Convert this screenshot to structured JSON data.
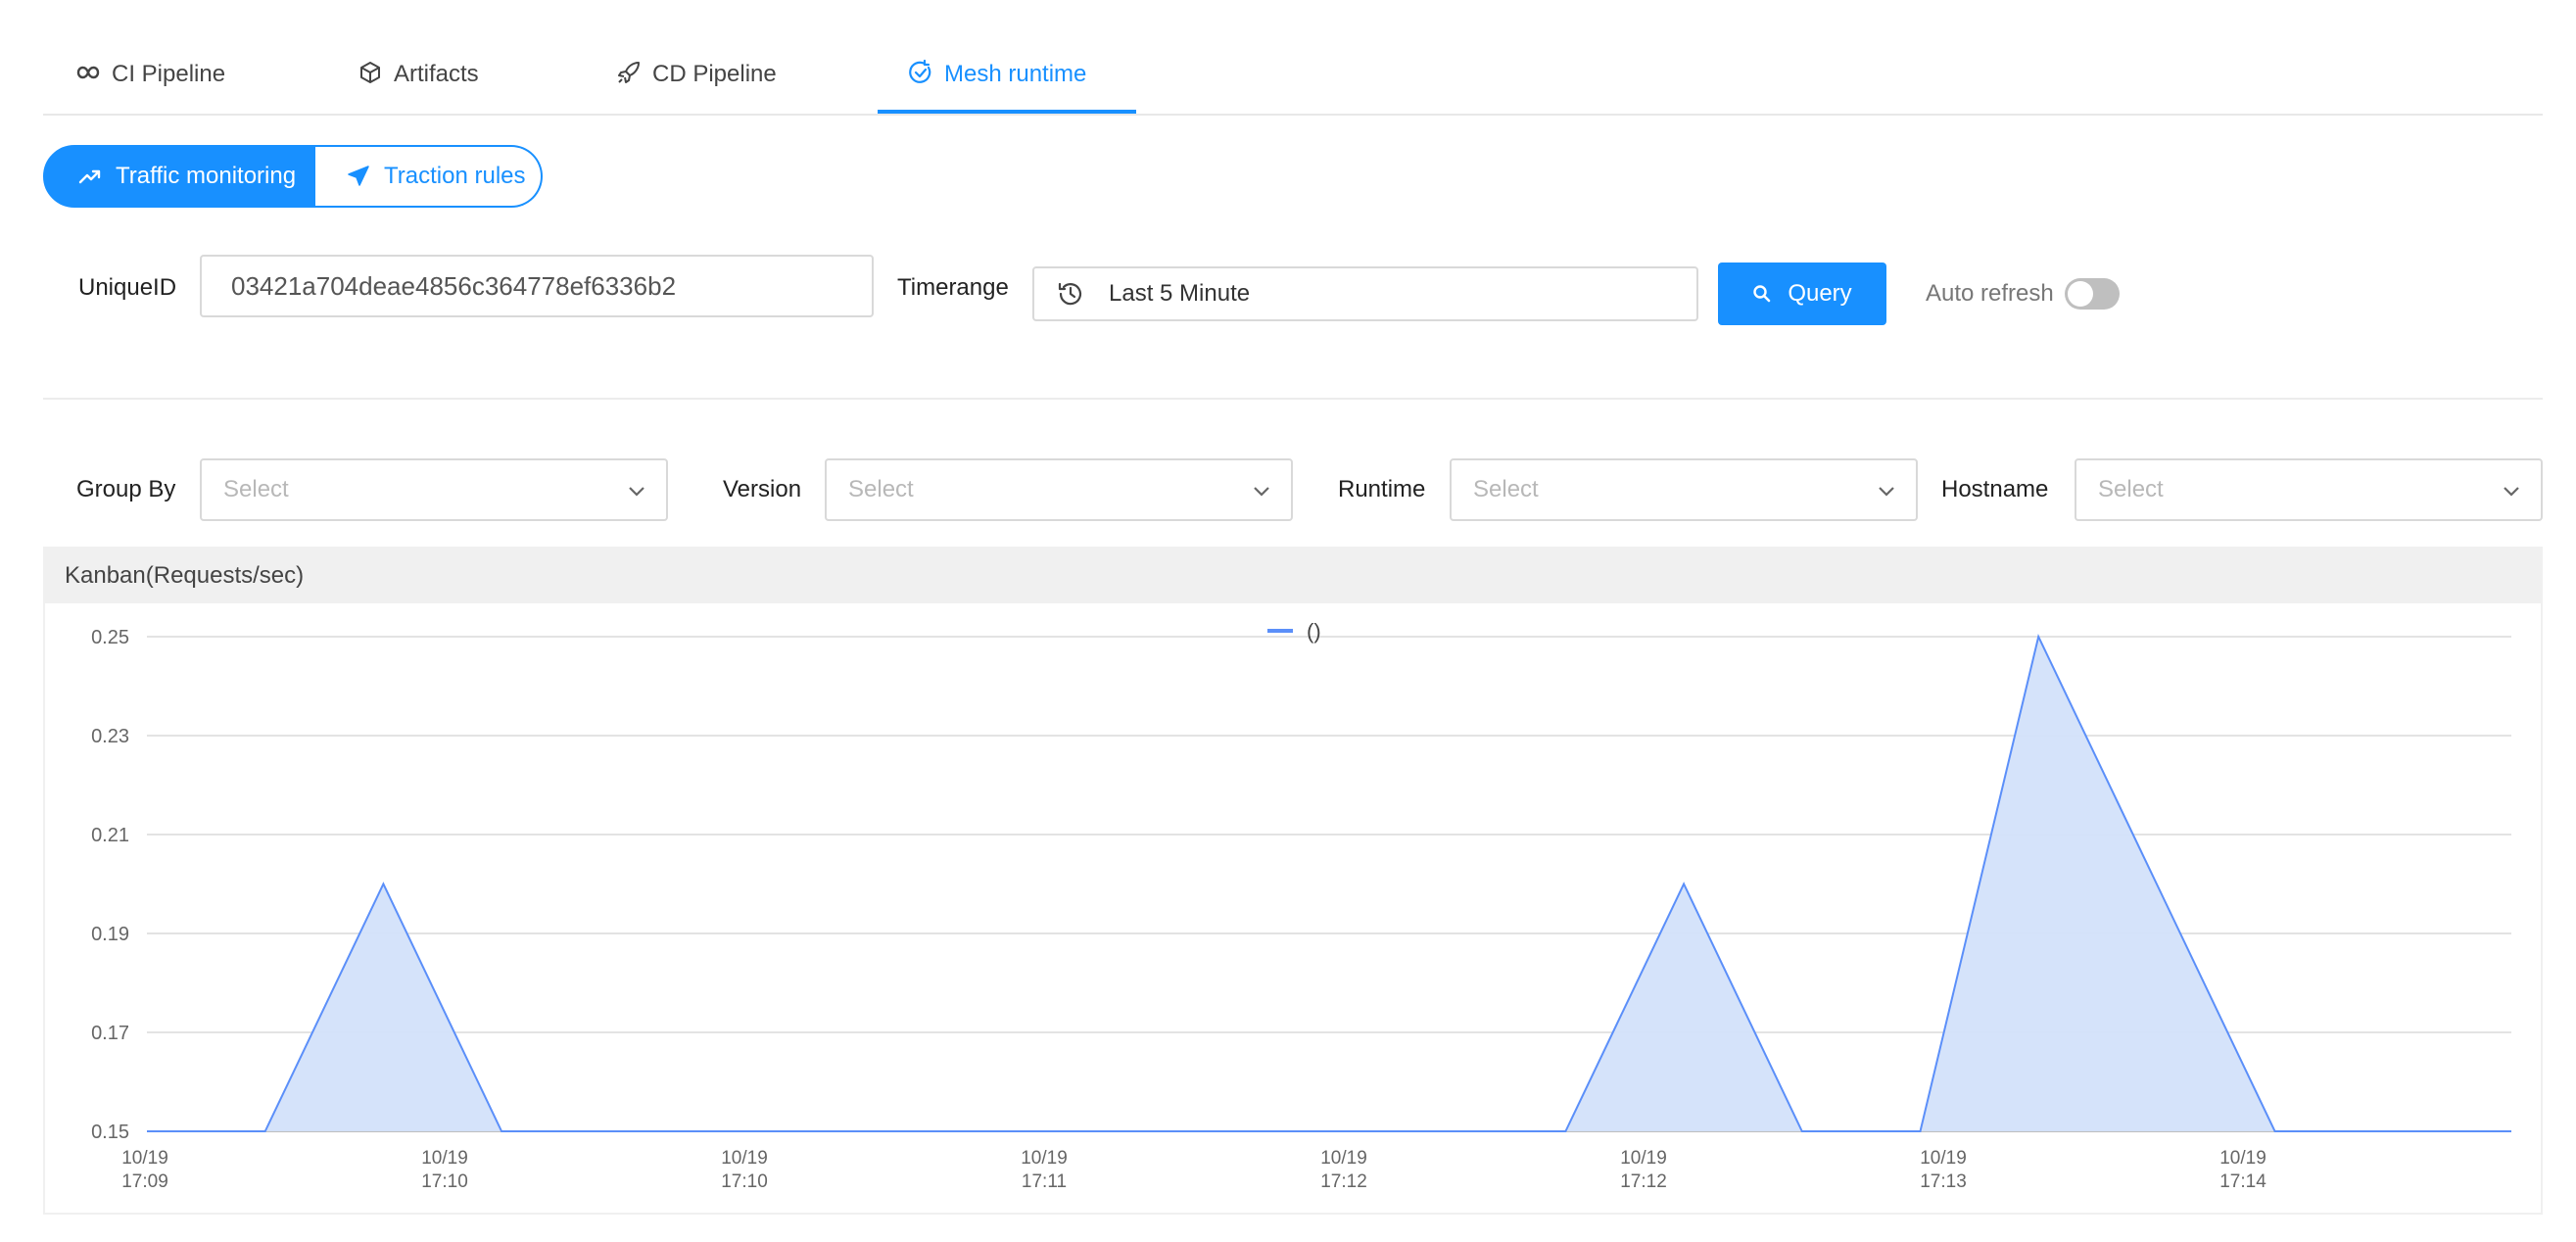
{
  "tabs": [
    {
      "label": "CI Pipeline",
      "icon": "infinity-icon"
    },
    {
      "label": "Artifacts",
      "icon": "cube-icon"
    },
    {
      "label": "CD Pipeline",
      "icon": "rocket-icon"
    },
    {
      "label": "Mesh runtime",
      "icon": "refresh-check-icon",
      "active": true
    }
  ],
  "segment": {
    "traffic_label": "Traffic monitoring",
    "rules_label": "Traction rules"
  },
  "query": {
    "uniqueid_label": "UniqueID",
    "uniqueid_value": "03421a704deae4856c364778ef6336b2",
    "timerange_label": "Timerange",
    "timerange_value": "Last 5 Minute",
    "query_button": "Query",
    "auto_refresh_label": "Auto refresh",
    "auto_refresh_on": false
  },
  "filters": [
    {
      "label": "Group By",
      "placeholder": "Select"
    },
    {
      "label": "Version",
      "placeholder": "Select"
    },
    {
      "label": "Runtime",
      "placeholder": "Select"
    },
    {
      "label": "Hostname",
      "placeholder": "Select"
    }
  ],
  "colors": {
    "accent": "#1890ff",
    "series_line": "#5b8ff9",
    "series_fill": "#d3e2fa"
  },
  "chart_data": {
    "type": "area",
    "title": "Kanban(Requests/sec)",
    "legend": [
      {
        "name": "()",
        "placement": "top-center"
      }
    ],
    "ylim": [
      0.15,
      0.25
    ],
    "yticks": [
      "0.25",
      "0.23",
      "0.21",
      "0.19",
      "0.17",
      "0.15"
    ],
    "xticks": [
      "10/19 17:09",
      "10/19 17:10",
      "10/19 17:10",
      "10/19 17:11",
      "10/19 17:12",
      "10/19 17:12",
      "10/19 17:13",
      "10/19 17:14"
    ],
    "grid": true,
    "series": [
      {
        "name": "()",
        "values": [
          0.15,
          0.15,
          0.2,
          0.15,
          0.15,
          0.15,
          0.15,
          0.15,
          0.15,
          0.15,
          0.15,
          0.15,
          0.15,
          0.2,
          0.15,
          0.15,
          0.25,
          0.2,
          0.15,
          0.15,
          0.15
        ]
      }
    ]
  }
}
